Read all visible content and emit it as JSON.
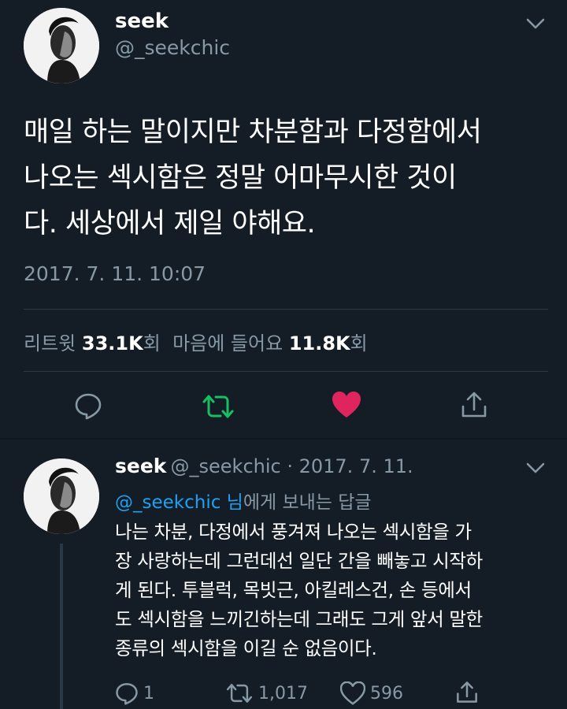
{
  "tweet": {
    "name": "seek",
    "handle": "@_seekchic",
    "text_lines": [
      "매일 하는 말이지만 차분함과 다정함에서",
      "나오는 섹시함은 정말 어마무시한 것이",
      "다. 세상에서 제일 야해요."
    ],
    "timestamp": "2017. 7. 11. 10:07",
    "stats": {
      "retweet_label": "리트윗",
      "retweet_count": "33.1K",
      "retweet_suffix": "회",
      "like_label": "마음에 들어요",
      "like_count": "11.8K",
      "like_suffix": "회"
    },
    "liked": true,
    "colors": {
      "retweet_green": "#17bf63",
      "like_red": "#e0245e"
    }
  },
  "reply": {
    "name": "seek",
    "handle_date": "@_seekchic · 2017. 7. 11.",
    "reply_to_mention": "@_seekchic 님",
    "reply_to_suffix": "에게 보내는 답글",
    "text_lines": [
      "나는 차분, 다정에서 풍겨져 나오는 섹시함을 가",
      "장 사랑하는데 그런데선 일단 간을 빼놓고 시작하",
      "게 된다. 투블럭, 목빗근, 아킬레스건, 손 등에서",
      "도 섹시함을 느끼긴하는데 그래도 그게 앞서 말한",
      "종류의 섹시함을 이길 순 없음이다."
    ],
    "reply_count": "1",
    "retweet_count": "1,017",
    "like_count": "596"
  }
}
